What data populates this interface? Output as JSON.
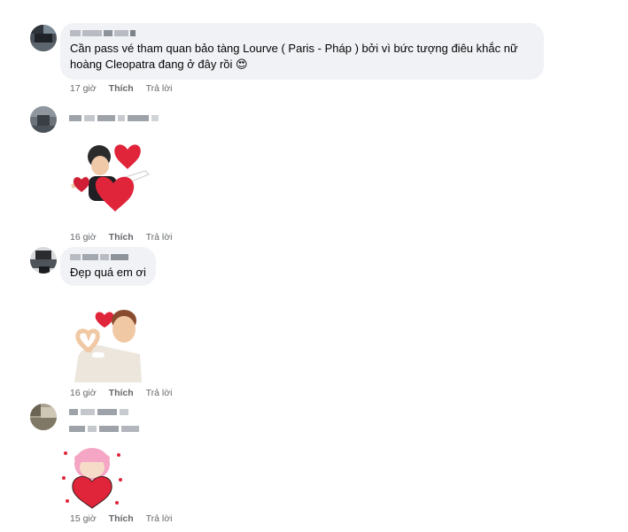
{
  "comments": [
    {
      "text": "Cần pass vé tham quan bảo tàng Lourve ( Paris - Pháp ) bởi vì bức tượng điêu khắc nữ hoàng Cleopatra đang ở đây rồi 😍",
      "time": "17 giờ",
      "like": "Thích",
      "reply": "Trả lời"
    },
    {
      "sticker": "boy-with-hearts-sticker",
      "time": "16 giờ",
      "like": "Thích",
      "reply": "Trả lời"
    },
    {
      "text": "Đẹp quá em ơi",
      "sticker": "boy-heart-hands-sticker",
      "time": "16 giờ",
      "like": "Thích",
      "reply": "Trả lời"
    },
    {
      "sticker": "pink-hair-girl-heart-sticker",
      "time": "15 giờ",
      "like": "Thích",
      "reply": "Trả lời"
    }
  ],
  "colors": {
    "bubble": "#f0f2f5",
    "meta_text": "#65676b",
    "heart": "#e0243a"
  }
}
